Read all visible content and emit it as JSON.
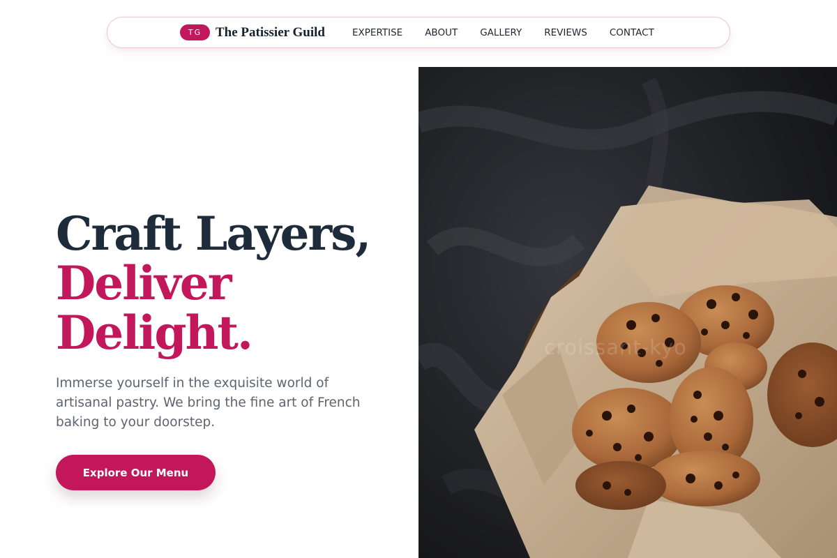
{
  "nav": {
    "badge": "TG",
    "brand_name": "The Patissier Guild",
    "links": [
      "EXPERTISE",
      "ABOUT",
      "GALLERY",
      "REVIEWS",
      "CONTACT"
    ]
  },
  "hero": {
    "headline_line1": "Craft Layers,",
    "headline_line2": "Deliver",
    "headline_line3": "Delight.",
    "description": "Immerse yourself in the exquisite world of artisanal pastry. We bring the fine art of French baking to your doorstep.",
    "cta_label": "Explore Our Menu"
  },
  "photo": {
    "watermark": "croissant-kyo",
    "subject": "cookies-in-bowl-image"
  },
  "colors": {
    "accent": "#c2185b",
    "headline": "#1e2b3a",
    "body_text": "#5c6470",
    "nav_border": "#efc7d4"
  }
}
